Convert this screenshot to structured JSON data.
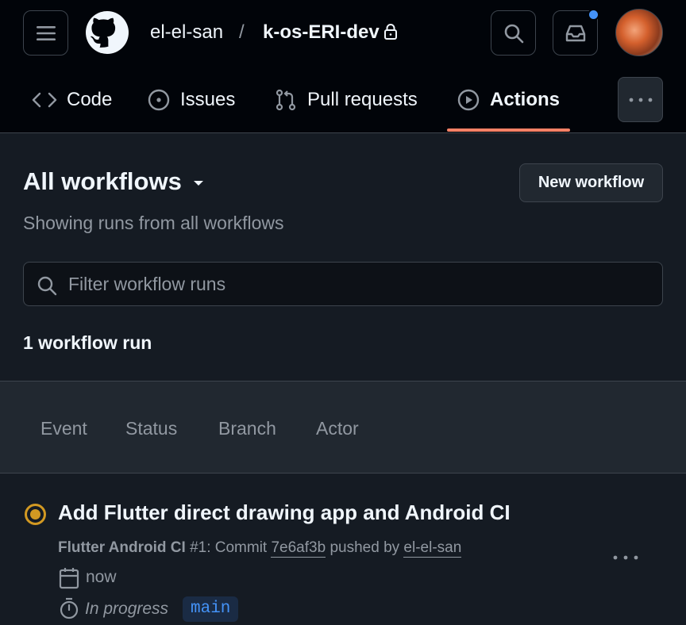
{
  "header": {
    "owner": "el-el-san",
    "separator": "/",
    "repo": "k-os-ERI-dev",
    "icons": [
      "menu-icon",
      "github-logo-icon",
      "lock-icon",
      "search-icon",
      "inbox-icon",
      "kebab-icon"
    ],
    "notification_dot_color": "#4493f8"
  },
  "tabs": [
    {
      "label": "Code",
      "icon": "code-icon"
    },
    {
      "label": "Issues",
      "icon": "issue-opened-icon"
    },
    {
      "label": "Pull requests",
      "icon": "git-pull-request-icon"
    },
    {
      "label": "Actions",
      "icon": "play-icon",
      "selected": true
    }
  ],
  "accent_color": "#f78166",
  "main": {
    "title": "All workflows",
    "new_workflow_label": "New workflow",
    "subtitle": "Showing runs from all workflows",
    "filter_placeholder": "Filter workflow runs",
    "run_count": "1 workflow run",
    "filters": [
      "Event",
      "Status",
      "Branch",
      "Actor"
    ]
  },
  "run": {
    "title": "Add Flutter direct drawing app and Android CI",
    "workflow_name": "Flutter Android CI",
    "run_number": "#1",
    "commit_prefix": ": Commit ",
    "commit_sha": "7e6af3b",
    "pushed_by_text": " pushed by ",
    "actor": "el-el-san",
    "time": "now",
    "status": "In progress",
    "branch": "main",
    "status_color": "#d29922"
  }
}
